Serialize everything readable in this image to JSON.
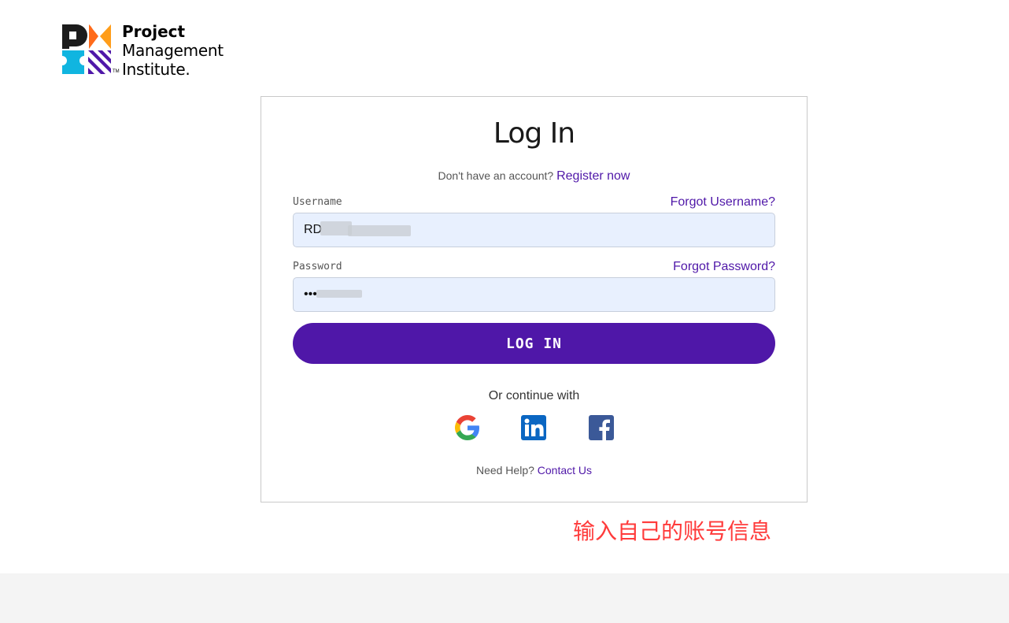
{
  "logo": {
    "line1": "Project",
    "line2": "Management",
    "line3": "Institute.",
    "tm": "TM"
  },
  "card": {
    "title": "Log In",
    "no_account_text": "Don't have an account?",
    "register_link": "Register now",
    "username_label": "Username",
    "forgot_username": "Forgot Username?",
    "username_value": "RD",
    "password_label": "Password",
    "forgot_password": "Forgot Password?",
    "password_value": "•••",
    "login_button": "LOG IN",
    "continue_text": "Or continue with",
    "help_text": "Need Help?",
    "contact_link": "Contact Us"
  },
  "social": [
    {
      "icon": "google-icon"
    },
    {
      "icon": "linkedin-icon"
    },
    {
      "icon": "facebook-icon"
    }
  ],
  "annotation": "输入自己的账号信息",
  "colors": {
    "brand_purple": "#4f17a8",
    "input_bg": "#e8f0fe",
    "annotation_red": "#ff3b3b",
    "footer_bg": "#f4f4f4"
  }
}
